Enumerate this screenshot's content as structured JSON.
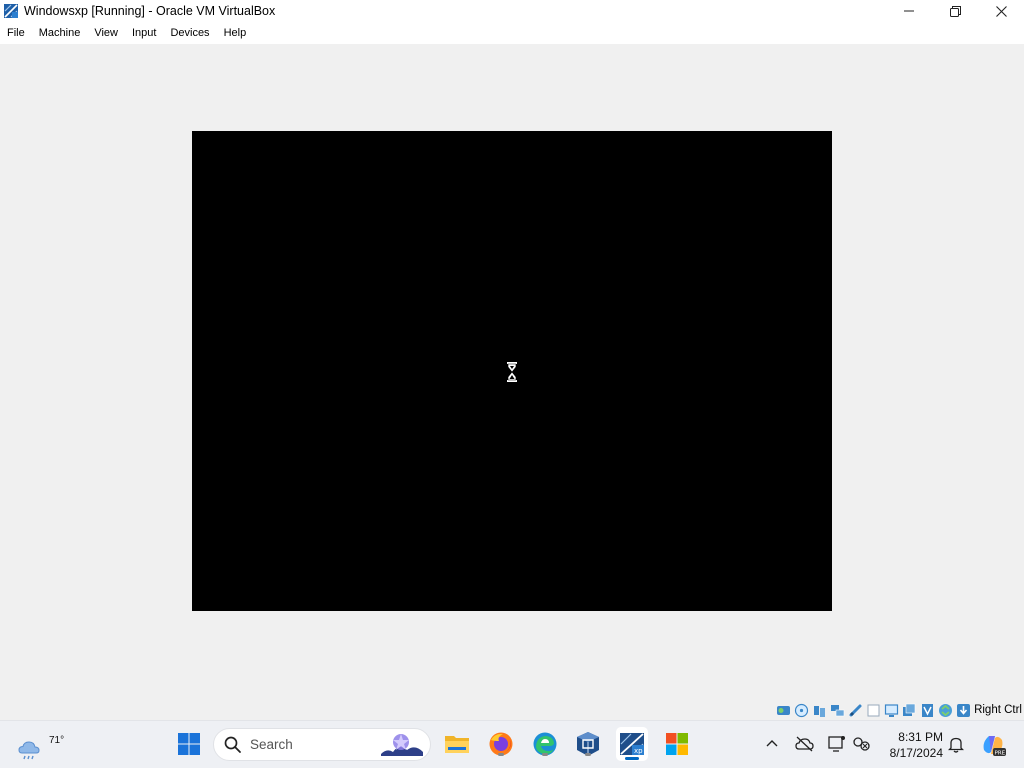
{
  "window": {
    "title": "Windowsxp [Running] - Oracle VM VirtualBox"
  },
  "menu": {
    "items": [
      "File",
      "Machine",
      "View",
      "Input",
      "Devices",
      "Help"
    ]
  },
  "statusbar": {
    "host_key": "Right Ctrl",
    "icons": [
      "hard-disk-icon",
      "optical-drive-icon",
      "audio-icon",
      "network-icon",
      "usb-icon",
      "shared-folders-icon",
      "display-icon",
      "recording-icon",
      "cpu-icon",
      "mouse-integration-icon",
      "keyboard-icon"
    ]
  },
  "taskbar": {
    "weather_temp": "71°",
    "search_placeholder": "Search",
    "apps": [
      "start-icon",
      "file-explorer-icon",
      "firefox-icon",
      "edge-icon",
      "virtualbox-icon",
      "virtualbox-vm-icon",
      "microsoft-store-icon"
    ],
    "clock_time": "8:31 PM",
    "clock_date": "8/17/2024"
  },
  "colors": {
    "vm_screen": "#000000",
    "window_bg": "#f0f0f0",
    "taskbar_bg": "#eef0f4",
    "accent": "#0067c0"
  }
}
